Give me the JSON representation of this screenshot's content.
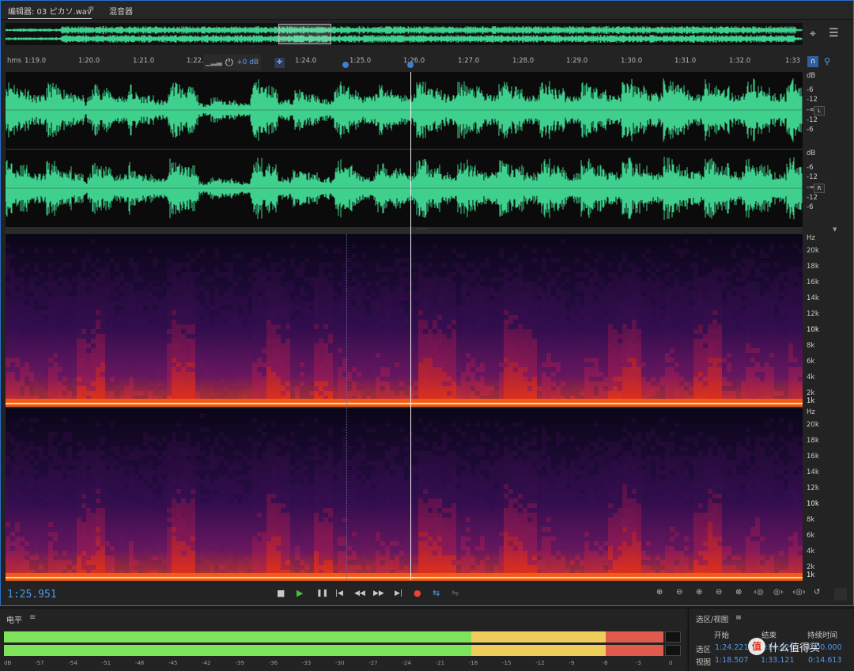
{
  "tabs": {
    "editor_label": "编辑器: 03 ピカソ.wav",
    "menu_glyph": "≡",
    "mixer_label": "混音器"
  },
  "ruler": {
    "unit": "hms",
    "ticks": [
      "1:19.0",
      "1:20.0",
      "1:21.0",
      "1:22.0",
      "1:24.0",
      "1:25.0",
      "1:26.0",
      "1:27.0",
      "1:28.0",
      "1:29.0",
      "1:30.0",
      "1:31.0",
      "1:32.0",
      "1:33"
    ],
    "hud_gain": "+0 dB"
  },
  "wave_scale": {
    "unit": "dB",
    "labels": [
      "-6",
      "-12",
      "-∞",
      "-12",
      "-6"
    ],
    "left_channel": "L",
    "right_channel": "R"
  },
  "spec_scale": {
    "unit": "Hz",
    "labels": [
      "20k",
      "18k",
      "16k",
      "14k",
      "12k",
      "10k",
      "8k",
      "6k",
      "4k",
      "2k",
      "1k"
    ]
  },
  "transport": {
    "timecode": "1:25.951",
    "stop": "■",
    "play": "▶",
    "pause": "❚❚",
    "to_start": "|◀",
    "rewind": "◀◀",
    "forward": "▶▶",
    "to_end": "▶|",
    "record": "●",
    "loop": "⇆",
    "skip": "⇋"
  },
  "levels": {
    "title": "电平",
    "menu_glyph": "≡",
    "scale": [
      "dB",
      "-57",
      "-54",
      "-51",
      "-48",
      "-45",
      "-42",
      "-39",
      "-36",
      "-33",
      "-30",
      "-27",
      "-24",
      "-21",
      "-18",
      "-15",
      "-12",
      "-9",
      "-6",
      "-3",
      "0"
    ],
    "colors": {
      "green": "#7de35a",
      "yellow": "#efcd5b",
      "red": "#e05a4e"
    }
  },
  "selection_view": {
    "title": "选区/视图",
    "menu_glyph": "≡",
    "col_start": "开始",
    "col_end": "结束",
    "col_duration": "持续时间",
    "row_selection": "选区",
    "row_view": "视图",
    "sel_start": "1:24.221",
    "sel_end": "1:24.221",
    "sel_duration": "0:00.000",
    "view_start": "1:18.507",
    "view_end": "1:33.121",
    "view_duration": "0:14.613"
  },
  "watermark": {
    "text": "什么值得买",
    "icon": "值"
  },
  "colors": {
    "waveform": "#3fd08d",
    "accent": "#4f9ae8",
    "background": "#232323"
  }
}
